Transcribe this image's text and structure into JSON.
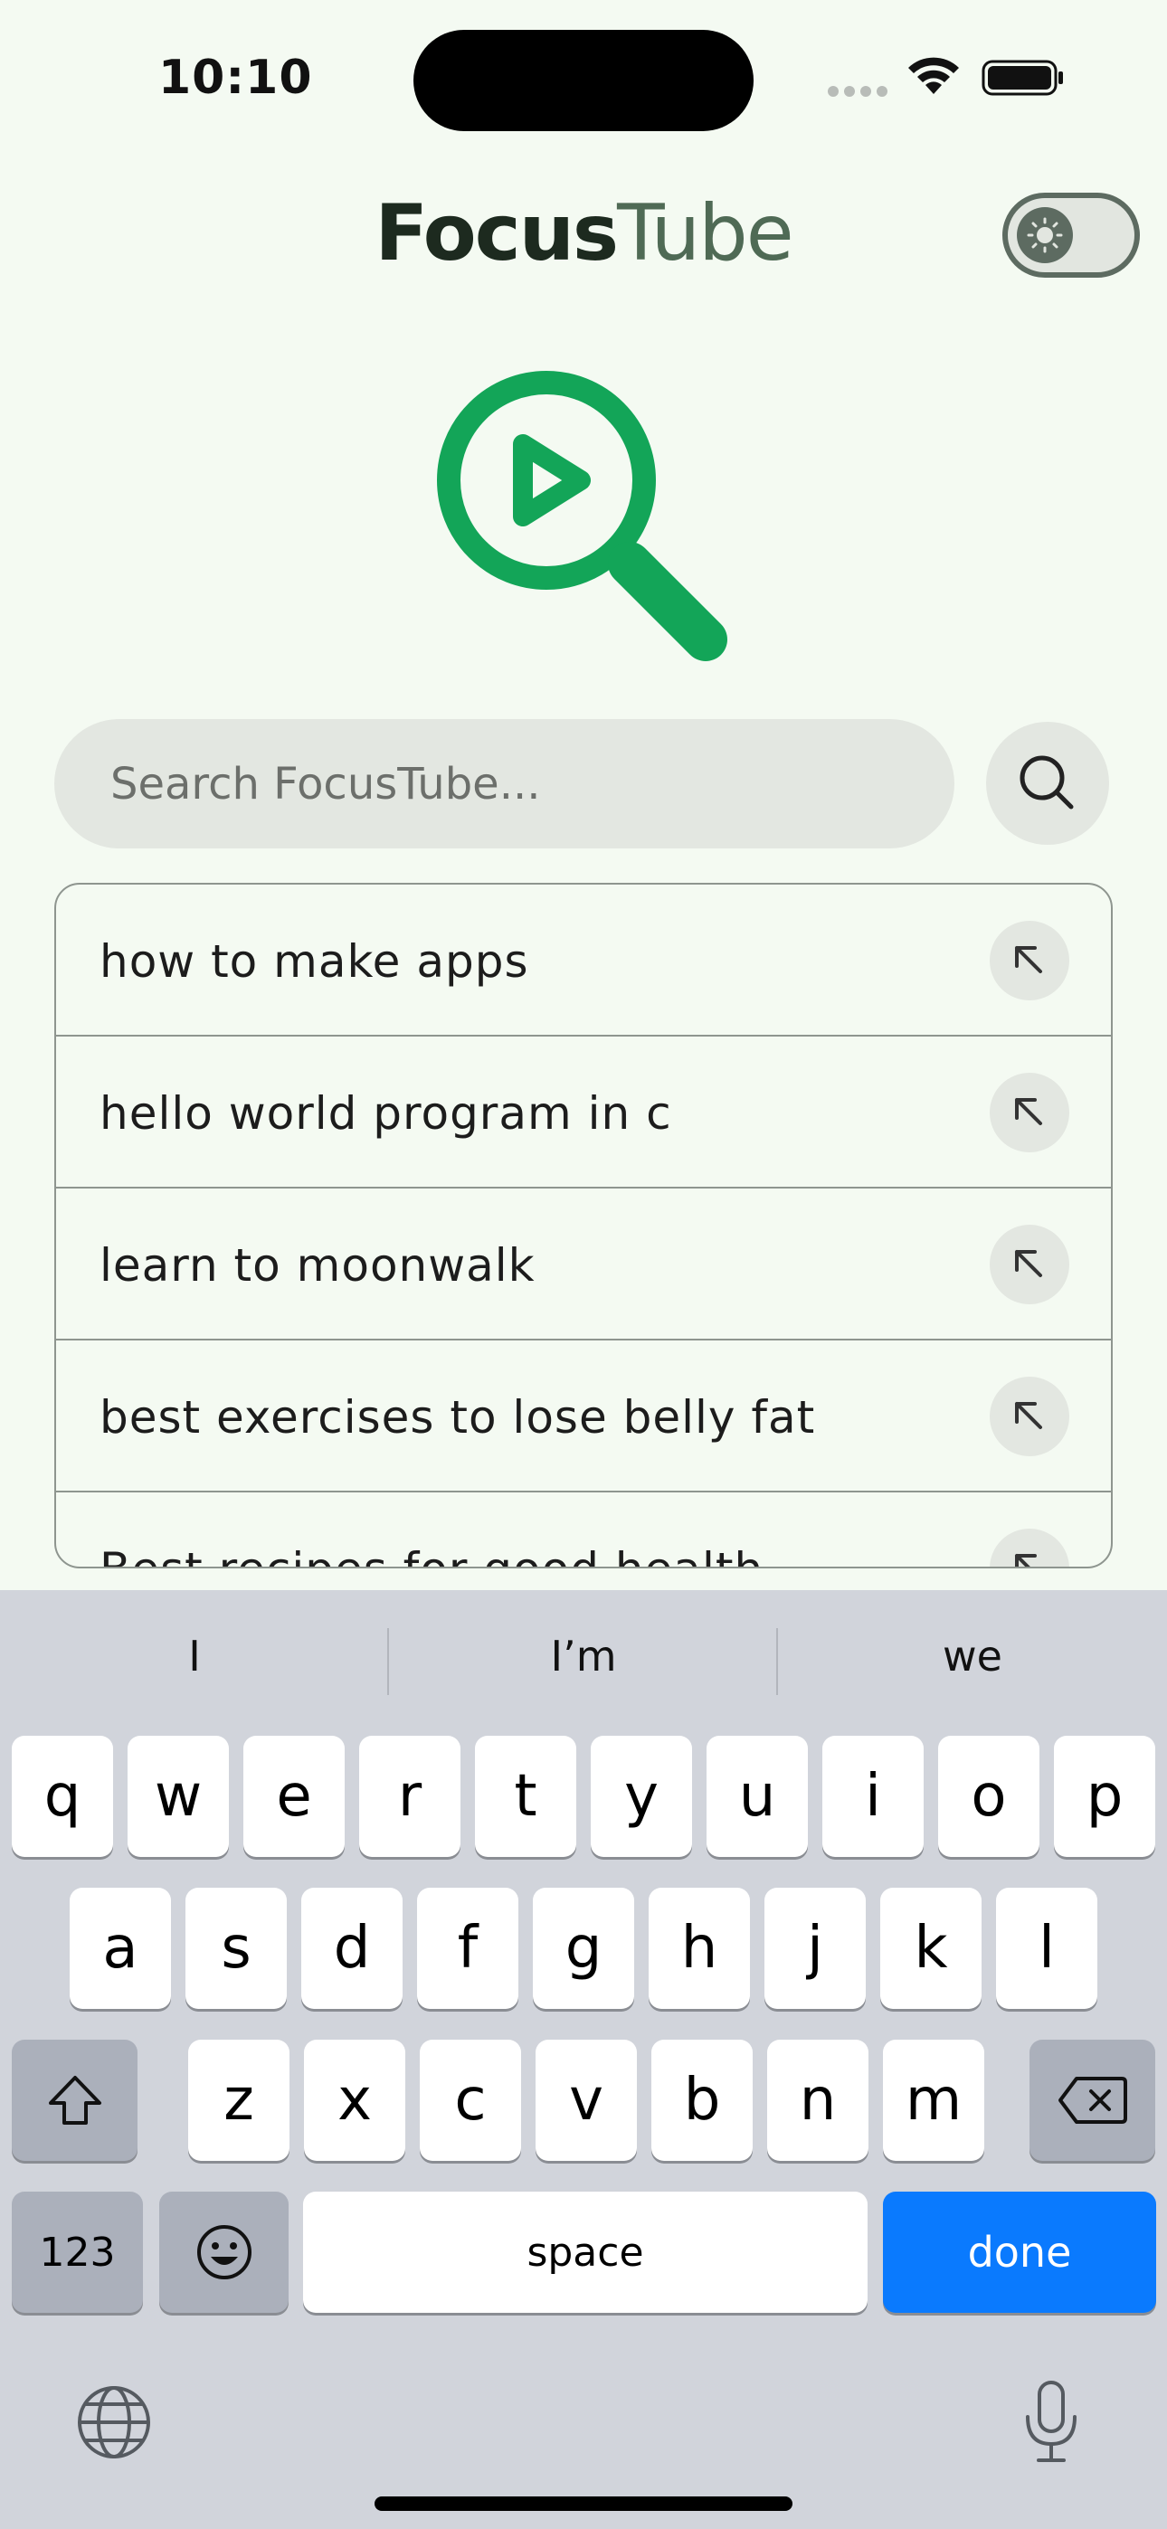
{
  "status": {
    "time": "10:10"
  },
  "header": {
    "title_primary": "Focus",
    "title_accent": "Tube"
  },
  "search": {
    "placeholder": "Search FocusTube..."
  },
  "suggestions": [
    "how to make apps",
    "hello world program in c",
    "learn to moonwalk",
    "best exercises to lose belly fat",
    "Best recipes for good health"
  ],
  "keyboard": {
    "predictions": [
      "I",
      "I’m",
      "we"
    ],
    "row1": [
      "q",
      "w",
      "e",
      "r",
      "t",
      "y",
      "u",
      "i",
      "o",
      "p"
    ],
    "row2": [
      "a",
      "s",
      "d",
      "f",
      "g",
      "h",
      "j",
      "k",
      "l"
    ],
    "row3": [
      "z",
      "x",
      "c",
      "v",
      "b",
      "n",
      "m"
    ],
    "numbers_label": "123",
    "space_label": "space",
    "done_label": "done"
  },
  "colors": {
    "brand_green": "#13a558",
    "accent_blue": "#0a7afe"
  },
  "icons": [
    "theme-toggle-sun-icon",
    "play-magnifier-logo-icon",
    "search-icon",
    "arrow-up-left-icon",
    "shift-icon",
    "delete-icon",
    "emoji-icon",
    "globe-icon",
    "microphone-icon"
  ]
}
